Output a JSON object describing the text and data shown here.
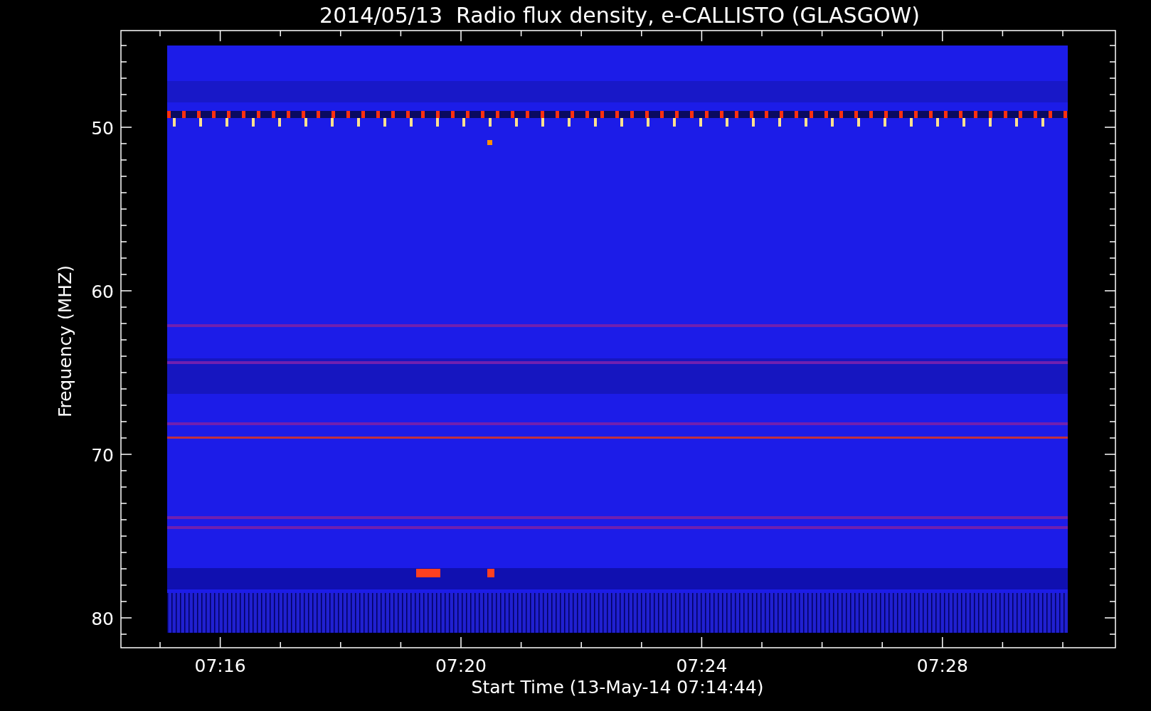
{
  "title": "2014/05/13  Radio flux density, e-CALLISTO (GLASGOW)",
  "y_axis": {
    "label": "Frequency (MHZ)",
    "ticks": [
      "50",
      "60",
      "70",
      "80"
    ]
  },
  "x_axis": {
    "label": "Start Time (13-May-14 07:14:44)",
    "ticks": [
      "07:16",
      "07:20",
      "07:24",
      "07:28"
    ]
  }
}
